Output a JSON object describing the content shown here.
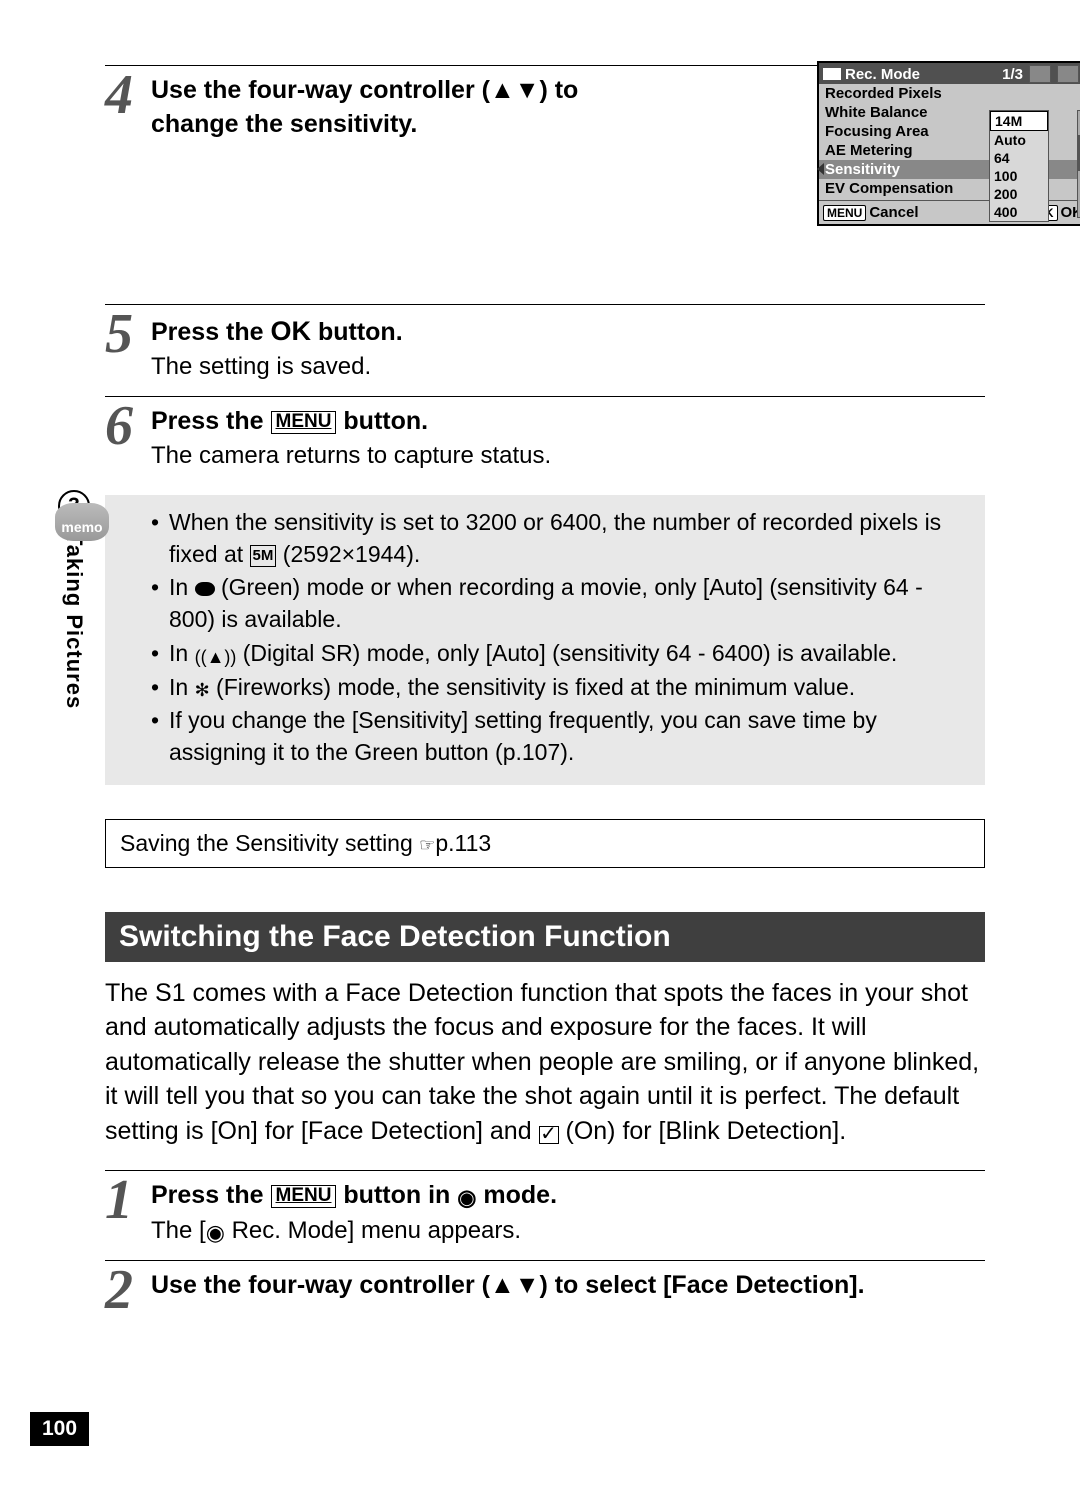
{
  "sideTab": {
    "chapter": "3",
    "title": "Taking Pictures"
  },
  "pageNumber": "100",
  "step4": {
    "num": "4",
    "head_a": "Use the four-way controller (",
    "head_arrows": "▲▼",
    "head_b": ") to change the sensitivity."
  },
  "menuScreen": {
    "title": "Rec. Mode",
    "page": "1/3",
    "rows": [
      {
        "label": "Recorded Pixels",
        "value": "14M"
      },
      {
        "label": "White Balance",
        "value": "Auto"
      },
      {
        "label": "Focusing Area",
        "value": "64"
      },
      {
        "label": "AE Metering",
        "value": "100"
      },
      {
        "label": "Sensitivity",
        "value": "200"
      },
      {
        "label": "EV Compensation",
        "value": "400"
      }
    ],
    "footer": {
      "leftKey": "MENU",
      "left": "Cancel",
      "rightKey": "OK",
      "right": "OK"
    }
  },
  "step5": {
    "num": "5",
    "head_a": "Press the ",
    "ok": "OK",
    "head_b": " button.",
    "sub": "The setting is saved."
  },
  "step6": {
    "num": "6",
    "head_a": "Press the ",
    "menu": "MENU",
    "head_b": " button.",
    "sub": "The camera returns to capture status."
  },
  "memo": {
    "tag": "memo",
    "items": {
      "a": {
        "t1": "When the sensitivity is set to 3200 or 6400, the number of recorded pixels is fixed at ",
        "icon": "5M",
        "t2": " (2592×1944)."
      },
      "b": {
        "t1": "In ",
        "t2": " (Green) mode or when recording a movie, only [Auto] (sensitivity 64 - 800) is available."
      },
      "c": {
        "t1": "In ",
        "t2": " (Digital SR) mode, only [Auto] (sensitivity 64 - 6400) is available."
      },
      "d": {
        "t1": "In ",
        "t2": " (Fireworks) mode, the sensitivity is fixed at the minimum value."
      },
      "e": {
        "t1": "If you change the [Sensitivity] setting frequently, you can save time by assigning it to the Green button (p.107)."
      }
    }
  },
  "savingBox": {
    "text": "Saving the Sensitivity setting ",
    "ref": "p.113"
  },
  "sectionTitle": "Switching the Face Detection Function",
  "sectionPara": {
    "t1": "The S1 comes with a Face Detection function that spots the faces in your shot and automatically adjusts the focus and exposure for the faces. It will automatically release the shutter when people are smiling, or if anyone blinked, it will tell you that so you can take the shot again until it is perfect. The default setting is [On] for [Face Detection] and ",
    "t2": " (On) for [Blink Detection]."
  },
  "stepB1": {
    "num": "1",
    "head_a": "Press the ",
    "menu": "MENU",
    "head_b": " button in ",
    "head_c": " mode.",
    "sub_a": "The [",
    "sub_b": " Rec. Mode] menu appears."
  },
  "stepB2": {
    "num": "2",
    "head_a": "Use the four-way controller (",
    "arrows": "▲▼",
    "head_b": ") to select [Face Detection]."
  }
}
